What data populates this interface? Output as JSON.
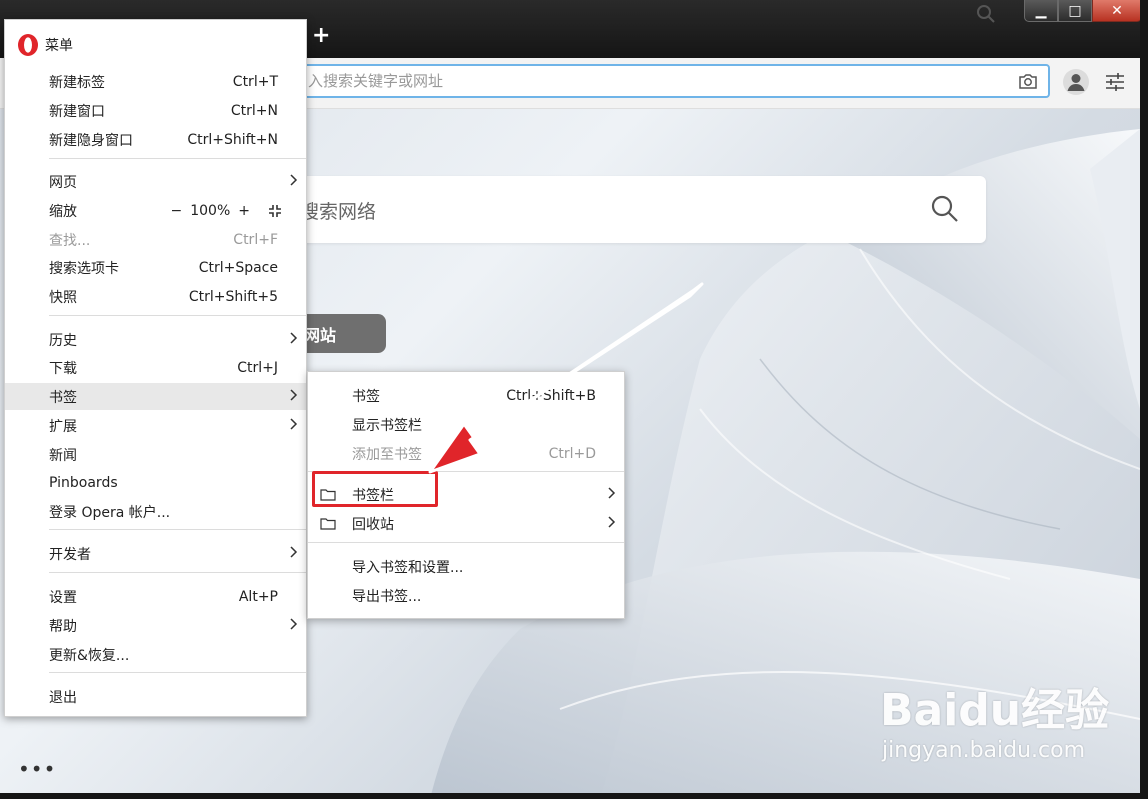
{
  "window": {
    "new_tab_symbol": "+",
    "minimize_symbol": "▁",
    "maximize_symbol": "□",
    "close_symbol": "✕"
  },
  "toolbar": {
    "address_placeholder": "入搜索关键字或网址"
  },
  "speed_dial": {
    "search_placeholder": "搜索网络",
    "add_site_label": "网站"
  },
  "sidebar": {
    "more_symbol": "•••"
  },
  "main_menu": {
    "title": "菜单",
    "items": [
      {
        "label": "新建标签",
        "shortcut": "Ctrl+T"
      },
      {
        "label": "新建窗口",
        "shortcut": "Ctrl+N"
      },
      {
        "label": "新建隐身窗口",
        "shortcut": "Ctrl+Shift+N"
      },
      {
        "label": "网页",
        "shortcut": ""
      },
      {
        "label": "缩放",
        "shortcut": ""
      },
      {
        "label": "查找...",
        "shortcut": "Ctrl+F"
      },
      {
        "label": "搜索选项卡",
        "shortcut": "Ctrl+Space"
      },
      {
        "label": "快照",
        "shortcut": "Ctrl+Shift+5"
      },
      {
        "label": "历史",
        "shortcut": ""
      },
      {
        "label": "下载",
        "shortcut": "Ctrl+J"
      },
      {
        "label": "书签",
        "shortcut": ""
      },
      {
        "label": "扩展",
        "shortcut": ""
      },
      {
        "label": "新闻",
        "shortcut": ""
      },
      {
        "label": "Pinboards",
        "shortcut": ""
      },
      {
        "label": "登录 Opera 帐户...",
        "shortcut": ""
      },
      {
        "label": "开发者",
        "shortcut": ""
      },
      {
        "label": "设置",
        "shortcut": "Alt+P"
      },
      {
        "label": "帮助",
        "shortcut": ""
      },
      {
        "label": "更新&恢复...",
        "shortcut": ""
      },
      {
        "label": "退出",
        "shortcut": ""
      }
    ],
    "zoom": {
      "minus": "−",
      "value": "100%",
      "plus": "+"
    }
  },
  "bookmarks_menu": {
    "items": [
      {
        "label": "书签",
        "shortcut": "Ctrl+Shift+B"
      },
      {
        "label": "显示书签栏",
        "shortcut": ""
      },
      {
        "label": "添加至书签",
        "shortcut": "Ctrl+D"
      },
      {
        "label": "书签栏",
        "shortcut": ""
      },
      {
        "label": "回收站",
        "shortcut": ""
      },
      {
        "label": "导入书签和设置...",
        "shortcut": ""
      },
      {
        "label": "导出书签...",
        "shortcut": ""
      }
    ]
  },
  "watermark": {
    "brand": "Baidu经验",
    "url": "jingyan.baidu.com"
  },
  "colors": {
    "accent_blue": "#6fb4e8",
    "opera_red": "#e0252a",
    "annotation_red": "#e0252a"
  }
}
